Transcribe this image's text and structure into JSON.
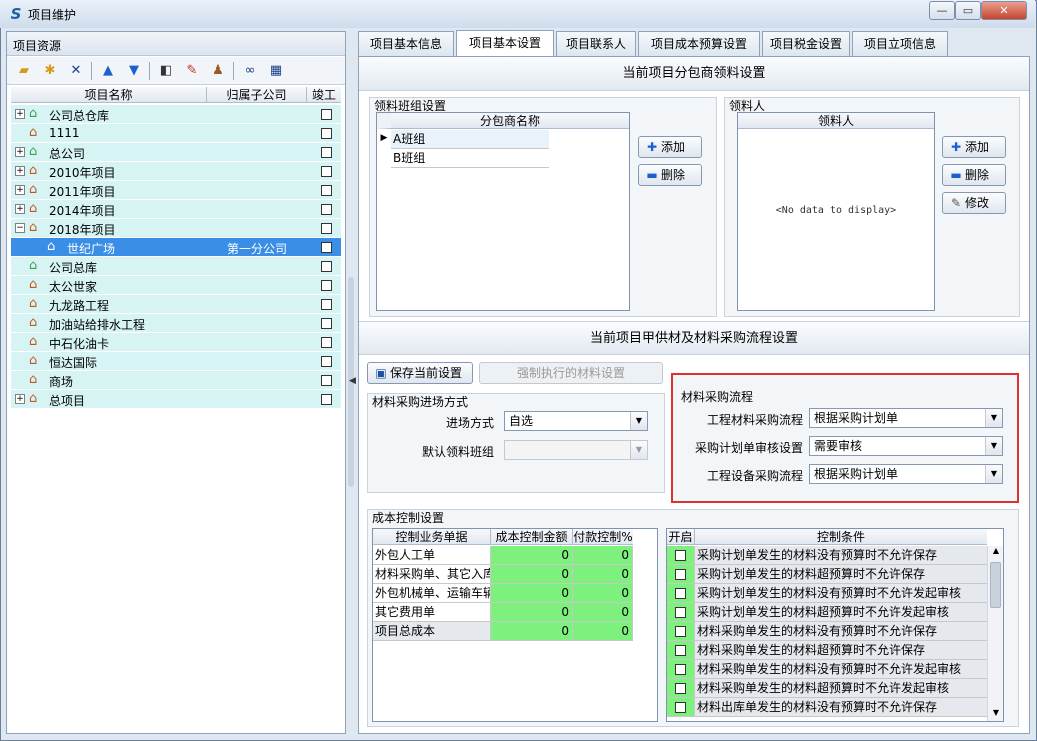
{
  "window": {
    "title": "项目维护",
    "icon": "app-logo-icon",
    "btn_min": "—",
    "btn_max": "▭",
    "btn_close": "✕"
  },
  "left_panel": {
    "header": "项目资源",
    "toolbar": [
      "folder-open-icon",
      "folder-star-icon",
      "delete-icon",
      "arrow-up-icon",
      "arrow-down-icon",
      "tag-icon",
      "paint-icon",
      "users-icon",
      "binoculars-icon",
      "grid-icon"
    ],
    "columns": {
      "name": "项目名称",
      "sub": "归属子公司",
      "done": "竣工"
    },
    "rows": [
      {
        "label": "公司总仓库",
        "expander": "+",
        "level": 0,
        "icon": "warehouse-icon",
        "sub": ""
      },
      {
        "label": "1111",
        "expander": "",
        "level": 0,
        "icon": "house-icon",
        "sub": ""
      },
      {
        "label": "总公司",
        "expander": "+",
        "level": 0,
        "icon": "warehouse-icon",
        "sub": ""
      },
      {
        "label": "2010年项目",
        "expander": "+",
        "level": 0,
        "icon": "house-icon",
        "sub": ""
      },
      {
        "label": "2011年项目",
        "expander": "+",
        "level": 0,
        "icon": "house-icon",
        "sub": ""
      },
      {
        "label": "2014年项目",
        "expander": "+",
        "level": 0,
        "icon": "house-icon",
        "sub": ""
      },
      {
        "label": "2018年项目",
        "expander": "−",
        "level": 0,
        "icon": "house-icon",
        "sub": ""
      },
      {
        "label": "世纪广场",
        "expander": "",
        "level": 1,
        "icon": "house-icon",
        "sub": "第一分公司",
        "selected": true
      },
      {
        "label": "公司总库",
        "expander": "",
        "level": 0,
        "icon": "warehouse-icon",
        "sub": ""
      },
      {
        "label": "太公世家",
        "expander": "",
        "level": 0,
        "icon": "house-icon",
        "sub": ""
      },
      {
        "label": "九龙路工程",
        "expander": "",
        "level": 0,
        "icon": "house-icon",
        "sub": ""
      },
      {
        "label": "加油站给排水工程",
        "expander": "",
        "level": 0,
        "icon": "house-icon",
        "sub": ""
      },
      {
        "label": "中石化油卡",
        "expander": "",
        "level": 0,
        "icon": "house-icon",
        "sub": ""
      },
      {
        "label": "恒达国际",
        "expander": "",
        "level": 0,
        "icon": "house-icon",
        "sub": ""
      },
      {
        "label": "商场",
        "expander": "",
        "level": 0,
        "icon": "house-icon",
        "sub": ""
      },
      {
        "label": "总项目",
        "expander": "+",
        "level": 0,
        "icon": "house-icon",
        "sub": ""
      }
    ]
  },
  "tabs": [
    "项目基本信息",
    "项目基本设置",
    "项目联系人",
    "项目成本预算设置",
    "项目税金设置",
    "项目立项信息"
  ],
  "active_tab": 1,
  "section1": {
    "title": "当前项目分包商领料设置",
    "team_group": {
      "title": "领料班组设置",
      "col": "分包商名称",
      "rows": [
        "A班组",
        "B班组"
      ],
      "row_marker": "▶"
    },
    "team_buttons": {
      "add": "添加",
      "delete": "删除"
    },
    "picker_group": {
      "title": "领料人",
      "col": "领料人",
      "empty": "<No data to display>"
    },
    "picker_buttons": {
      "add": "添加",
      "delete": "删除",
      "edit": "修改"
    }
  },
  "section2": {
    "title": "当前项目甲供材及材料采购流程设置",
    "save_btn": "保存当前设置",
    "force_btn": "强制执行的材料设置",
    "entry": {
      "title": "材料采购进场方式",
      "mode_label": "进场方式",
      "mode_value": "自选",
      "team_label": "默认领料班组",
      "team_value": ""
    },
    "flow": {
      "title": "材料采购流程",
      "items": [
        {
          "label": "工程材料采购流程",
          "value": "根据采购计划单"
        },
        {
          "label": "采购计划单审核设置",
          "value": "需要审核"
        },
        {
          "label": "工程设备采购流程",
          "value": "根据采购计划单"
        }
      ],
      "highlight_color": "#e03030"
    },
    "cost": {
      "title": "成本控制设置",
      "cols": [
        "控制业务单据",
        "成本控制金额",
        "付款控制%"
      ],
      "rows": [
        {
          "name": "外包人工单",
          "amount": "0",
          "pay": "0"
        },
        {
          "name": "材料采购单、其它入库单",
          "amount": "0",
          "pay": "0"
        },
        {
          "name": "外包机械单、运输车辆单",
          "amount": "0",
          "pay": "0"
        },
        {
          "name": "其它费用单",
          "amount": "0",
          "pay": "0"
        },
        {
          "name": "项目总成本",
          "amount": "0",
          "pay": "0"
        }
      ],
      "cond_cols": [
        "开启",
        "控制条件"
      ],
      "conditions": [
        "采购计划单发生的材料没有预算时不允许保存",
        "采购计划单发生的材料超预算时不允许保存",
        "采购计划单发生的材料没有预算时不允许发起审核",
        "采购计划单发生的材料超预算时不允许发起审核",
        "材料采购单发生的材料没有预算时不允许保存",
        "材料采购单发生的材料超预算时不允许保存",
        "材料采购单发生的材料没有预算时不允许发起审核",
        "材料采购单发生的材料超预算时不允许发起审核",
        "材料出库单发生的材料没有预算时不允许保存"
      ],
      "green": "#7df07d"
    }
  }
}
